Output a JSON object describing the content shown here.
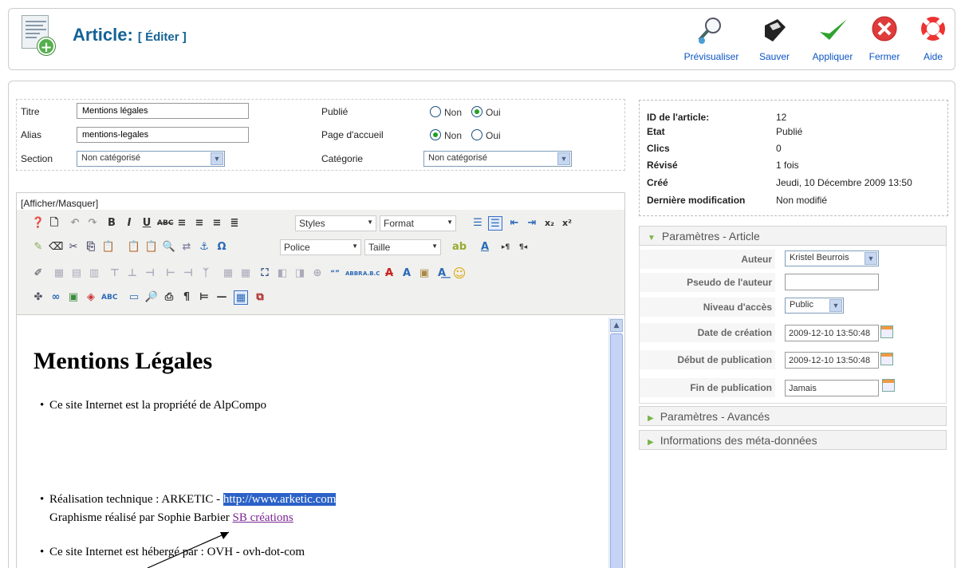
{
  "header": {
    "title": "Article:",
    "subtitle": "[ Éditer ]",
    "buttons": {
      "preview": "Prévisualiser",
      "save": "Sauver",
      "apply": "Appliquer",
      "close": "Fermer",
      "help": "Aide"
    }
  },
  "form": {
    "title_label": "Titre",
    "title_value": "Mentions légales",
    "alias_label": "Alias",
    "alias_value": "mentions-legales",
    "section_label": "Section",
    "section_value": "Non catégorisé",
    "published_label": "Publié",
    "frontpage_label": "Page d'accueil",
    "category_label": "Catégorie",
    "category_value": "Non catégorisé",
    "no_label": "Non",
    "yes_label": "Oui"
  },
  "editor": {
    "toggle": "[Afficher/Masquer]",
    "styles": "Styles",
    "format": "Format",
    "font": "Police",
    "size": "Taille",
    "heading": "Mentions Légales",
    "line1": "Ce site Internet est la propriété de AlpCompo",
    "line2_prefix": "Réalisation technique : ARKETIC - ",
    "line2_link": "http://www.arketic.com",
    "line3_prefix": "Graphisme réalisé par Sophie Barbier ",
    "line3_link": "SB créations",
    "line4": "Ce site Internet est hébergé par : OVH - ovh-dot-com"
  },
  "info": {
    "id_label": "ID de l'article:",
    "id_value": "12",
    "state_label": "Etat",
    "state_value": "Publié",
    "hits_label": "Clics",
    "hits_value": "0",
    "revised_label": "Révisé",
    "revised_value": "1 fois",
    "created_label": "Créé",
    "created_value": "Jeudi, 10 Décembre 2009 13:50",
    "modified_label": "Dernière modification",
    "modified_value": "Non modifié"
  },
  "params": {
    "article_title": "Paramètres - Article",
    "author_label": "Auteur",
    "author_value": "Kristel Beurrois",
    "alias_label": "Pseudo de l'auteur",
    "alias_value": "",
    "access_label": "Niveau d'accès",
    "access_value": "Public",
    "created_label": "Date de création",
    "created_value": "2009-12-10 13:50:48",
    "start_label": "Début de publication",
    "start_value": "2009-12-10 13:50:48",
    "end_label": "Fin de publication",
    "end_value": "Jamais",
    "advanced_title": "Paramètres - Avancés",
    "meta_title": "Informations des méta-données"
  }
}
